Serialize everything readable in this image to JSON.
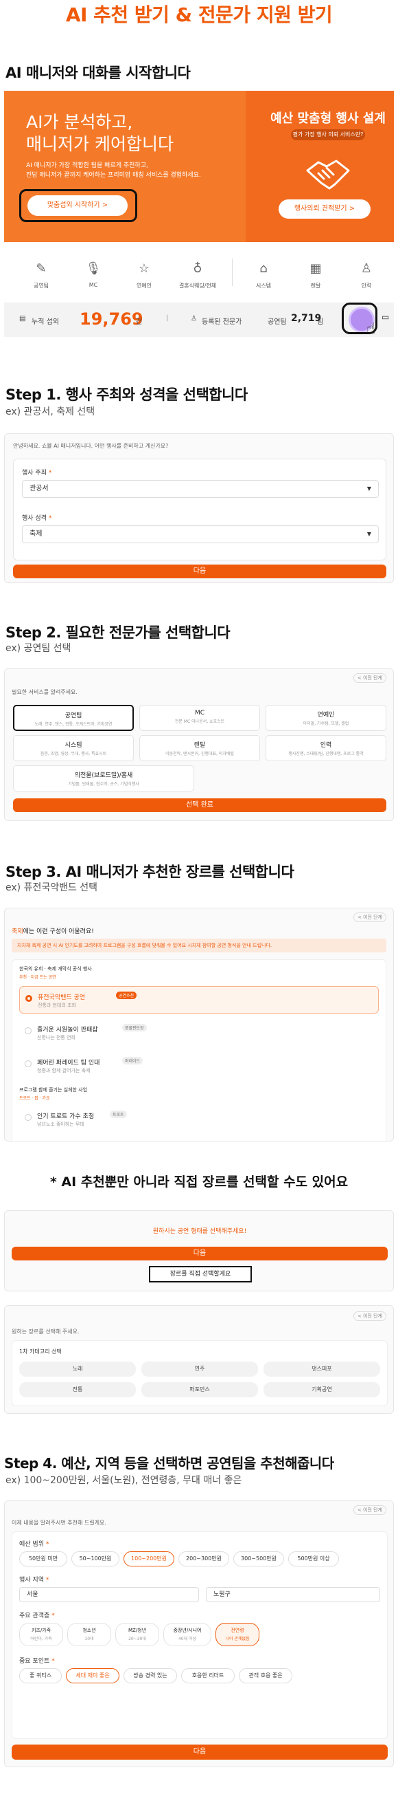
{
  "page": {
    "title": "AI 추천 받기 & 전문가 지원 받기"
  },
  "section0": {
    "heading": "AI 매니저와 대화를 시작합니다"
  },
  "hero": {
    "title_line1": "AI가 분석하고,",
    "title_line2": "매니저가 케어합니다",
    "desc_line1": "AI 매니저가 가장 적합한 팀을 빠르게 추천하고,",
    "desc_line2": "전담 매니저가 끝까지 케어하는 프리미엄 매칭 서비스를 경험하세요.",
    "cta": "맞춤섭외 시작하기 >",
    "right_title": "예산 맞춤형 행사 설계",
    "right_pill": "평가 가장 행사 의뢰 서비스란?",
    "right_cta": "행사의뢰 견적받기 >"
  },
  "categories": [
    {
      "icon": "✎",
      "label": "공연팀"
    },
    {
      "icon": "🎙",
      "label": "MC"
    },
    {
      "icon": "☆",
      "label": "연예인"
    },
    {
      "icon": "♁",
      "label": "결혼식웨딩/전체"
    },
    {
      "icon": "⌂",
      "label": "시스템"
    },
    {
      "icon": "▦",
      "label": "렌탈"
    },
    {
      "icon": "♙",
      "label": "인력"
    }
  ],
  "stats": {
    "cum_label": "누적 섭외",
    "cum_value": "19,769",
    "cum_unit": "건",
    "sep": "|",
    "reg_label": "등록된 전문가",
    "perf_label": "공연팀",
    "perf_value": "2,719",
    "perf_unit": "팀"
  },
  "step1": {
    "heading": "Step 1. 행사 주최와 성격을 선택합니다",
    "example": "ex) 관공서, 축제 선택",
    "greeting": "안녕하세요. 쇼뮬 AI 매니저입니다. 어떤 행사를 준비하고 계신가요?",
    "host_label": "행사 주최",
    "host_value": "관공서",
    "type_label": "행사 성격",
    "type_value": "축제",
    "next": "다음",
    "req": "*"
  },
  "step2": {
    "heading": "Step 2. 필요한 전문가를 선택합니다",
    "example": "ex) 공연팀 선택",
    "prev": "< 이전 단계",
    "prompt": "필요한 서비스를 알려주세요.",
    "services": [
      {
        "t": "공연팀",
        "d": "노래, 연주, 댄스, 전통, 오케스트라, 기획공연"
      },
      {
        "t": "MC",
        "d": "전문 MC 아나운서, 쇼호스트"
      },
      {
        "t": "연예인",
        "d": "아이돌, 가수팀, 모델, 셀럽"
      },
      {
        "t": "시스템",
        "d": "음향, 조명, 영상, 무대, 행사, 특효시트"
      },
      {
        "t": "렌탈",
        "d": "이동천막, 탠시폰커, 진행대표, 의자배렬"
      },
      {
        "t": "인력",
        "d": "행사진행, 스태핑/팀, 진행대행, 프로그 통역"
      },
      {
        "t": "의전물(브로드밀)/홍새",
        "d": "기념품, 인쇄물, 현수막, 굿즈, 기념식행사"
      }
    ],
    "confirm": "선택 완료"
  },
  "step3": {
    "heading": "Step 3. AI 매니저가 추천한 장르를 선택합니다",
    "example": "ex) 퓨전국악밴드 선택",
    "prev": "< 이전 단계",
    "intro_a": "축제",
    "intro_b": "에는 이런 구성이 어울려요!",
    "warn": "지자체 축제 공연 시 AI 인기도를 고려하여 프로그램을 구성 흐름에 맞춰볼 수 있어요 시지체 참여할 공연 형식을 안내 드립니다.",
    "group1_title": "한국의 유희 · 축제 개막식 공식 행사",
    "group1_tag": "추천 · 지금 뜨는 공연",
    "opt1_title": "퓨전국악밴드 공연",
    "opt1_badge": "공연추천",
    "opt1_desc": "전통과 현대의 조화",
    "opt2_title": "즐거운 시원놀이 판패잡",
    "opt2_badge": "풍물판단장",
    "opt2_desc": "신명나는 전통 연희",
    "opt3_title": "페어린 퍼레이드 팀 인대",
    "opt3_badge": "퍼레이드",
    "opt3_desc": "청중과 함께 걸어가는 축제",
    "group2_title": "프로그램 함께 즐기는 실체한 사업",
    "group2_tag": "트로트 · 팝 · 가요",
    "opt4_title": "인기 트로트 가수 초청",
    "opt4_badge": "트로트",
    "opt4_desc": "남녀노소 좋아하는 무대"
  },
  "direct": {
    "note": "* AI 추천뿐만 아니라 직접 장르를 선택할 수도 있어요",
    "top_prompt": "원하시는 공연 형태를 선택해주세요!",
    "next": "다음",
    "direct_btn": "장르를 직접 선택할게요",
    "prev": "< 이전 단계",
    "prompt": "원하는 장르를 선택해 주세요.",
    "cat_title": "1차 카테고리 선택",
    "genres": [
      "노래",
      "연주",
      "댄스퍼포",
      "전통",
      "퍼포먼스",
      "기획공연"
    ]
  },
  "step4": {
    "heading": "Step 4. 예산, 지역 등을 선택하면 공연팀을 추천해줍니다",
    "example": "ex) 100~200만원, 서울(노원), 전연령층, 무대 매너 좋은",
    "prev": "< 이전 단계",
    "prompt": "이제 내용을 알려주시면 추천해 드릴게요.",
    "budget_label": "예산 범위",
    "budgets": [
      "50만원 미만",
      "50~100만원",
      "100~200만원",
      "200~300만원",
      "300~500만원",
      "500만원 이상"
    ],
    "region_label": "행사 지역",
    "region_city": "서울",
    "region_district": "노원구",
    "audience_label": "주요 관객층",
    "audiences": [
      {
        "t": "키즈/가족",
        "d": "어린이, 가족"
      },
      {
        "t": "청소년",
        "d": "10대"
      },
      {
        "t": "MZ/청년",
        "d": "20~30대"
      },
      {
        "t": "중장년/시니어",
        "d": "40대 이상"
      },
      {
        "t": "전연령",
        "d": "나이 관계없음"
      }
    ],
    "point_label": "중요 포인트",
    "points": [
      "좋 퀴티스",
      "세대 재미 좋은",
      "방송 경력 있는",
      "호응한 리더트",
      "관객 호응 좋은"
    ],
    "next": "다음"
  }
}
